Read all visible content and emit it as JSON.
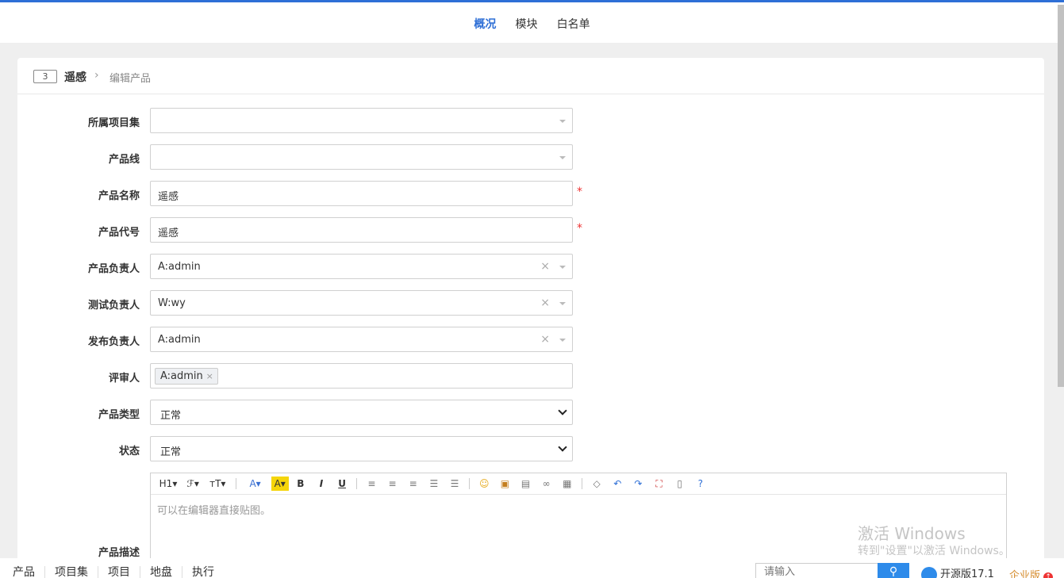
{
  "top_nav": {
    "items": [
      {
        "label": "概况",
        "active": true
      },
      {
        "label": "模块",
        "active": false
      },
      {
        "label": "白名单",
        "active": false
      }
    ]
  },
  "breadcrumb": {
    "id": "3",
    "product": "遥感",
    "separator": "›",
    "page": "编辑产品"
  },
  "form": {
    "program_label": "所属项目集",
    "program_value": "",
    "line_label": "产品线",
    "line_value": "",
    "name_label": "产品名称",
    "name_value": "遥感",
    "code_label": "产品代号",
    "code_value": "遥感",
    "po_label": "产品负责人",
    "po_value": "A:admin",
    "qd_label": "测试负责人",
    "qd_value": "W:wy",
    "rd_label": "发布负责人",
    "rd_value": "A:admin",
    "reviewer_label": "评审人",
    "reviewer_tag": "A:admin",
    "type_label": "产品类型",
    "type_value": "正常",
    "status_label": "状态",
    "status_value": "正常",
    "desc_label": "产品描述",
    "desc_placeholder": "可以在编辑器直接贴图。",
    "required_mark": "*",
    "clear_mark": "×"
  },
  "editor_toolbar": {
    "heading": "H1▾",
    "font": "ℱ▾",
    "size": "ᴛT▾",
    "font_color": "A▾",
    "bg_color": "A▾",
    "bold": "B",
    "italic": "I",
    "underline": "U"
  },
  "watermark": {
    "line1": "激活 Windows",
    "line2": "转到\"设置\"以激活 Windows。"
  },
  "bottom_nav": {
    "items": [
      "产品",
      "项目集",
      "项目",
      "地盘",
      "执行"
    ],
    "search_placeholder": "请输入",
    "search_icon": "⚲",
    "edition": "开源版17.1",
    "enterprise": "企业版",
    "upgrade_icon": "↑"
  },
  "colors": {
    "accent": "#2e6fd6",
    "required": "#ee3333",
    "enterprise": "#d58a2a"
  }
}
